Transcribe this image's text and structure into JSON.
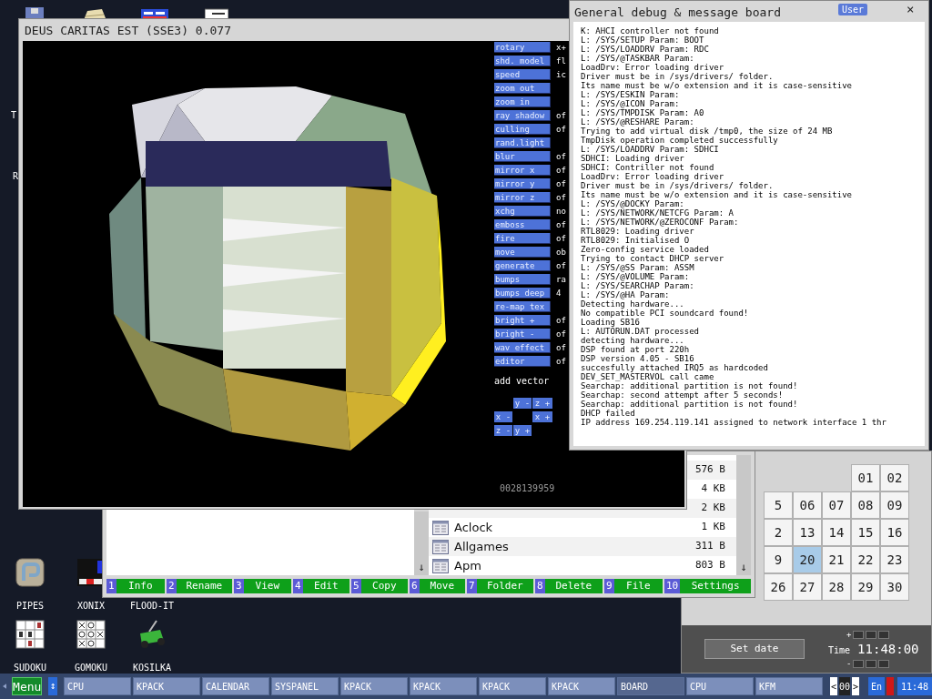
{
  "desktop": {
    "label_fragments": [
      "T",
      "R"
    ],
    "icons": [
      {
        "kind": "pipes",
        "label": "PIPES"
      },
      {
        "kind": "xonix",
        "label": "XONIX"
      },
      {
        "kind": "hidden",
        "label": "FLOOD-IT"
      },
      {
        "kind": "sudoku",
        "label": "SUDOKU"
      },
      {
        "kind": "gomoku",
        "label": "GOMOKU"
      },
      {
        "kind": "mower",
        "label": "KOSILKA"
      }
    ]
  },
  "render_window": {
    "title": "DEUS CARITAS EST (SSE3) 0.077",
    "controls": [
      {
        "label": "rotary",
        "value": "x+"
      },
      {
        "label": "shd. model",
        "value": "fl"
      },
      {
        "label": "speed",
        "value": "ic"
      },
      {
        "label": "zoom out"
      },
      {
        "label": "zoom in"
      },
      {
        "label": "ray shadow",
        "value": "of"
      },
      {
        "label": "culling",
        "value": "of"
      },
      {
        "label": "rand.light"
      },
      {
        "label": "blur",
        "value": "of"
      },
      {
        "label": "mirror x",
        "value": "of"
      },
      {
        "label": "mirror y",
        "value": "of"
      },
      {
        "label": "mirror z",
        "value": "of"
      },
      {
        "label": "xchg",
        "value": "no"
      },
      {
        "label": "emboss",
        "value": "of"
      },
      {
        "label": "fire",
        "value": "of"
      },
      {
        "label": "move",
        "value": "ob"
      },
      {
        "label": "generate",
        "value": "of"
      },
      {
        "label": "bumps",
        "value": "ra"
      },
      {
        "label": "bumps deep",
        "value": "4"
      },
      {
        "label": "re-map tex"
      },
      {
        "label": "bright +",
        "value": "of"
      },
      {
        "label": "bright -",
        "value": "of"
      },
      {
        "label": "wav effect",
        "value": "of"
      },
      {
        "label": "editor",
        "value": "of"
      }
    ],
    "add_vector_label": "add vector",
    "vector_buttons": [
      "y -",
      "z +",
      "x -",
      "x +",
      "z -",
      "y +"
    ],
    "counter": "0028139959"
  },
  "file_manager": {
    "files": [
      {
        "size": "576 B"
      },
      {
        "size": "4 KB"
      },
      {
        "size": "2 KB"
      },
      {
        "name": "Aclock",
        "size": "1 KB"
      },
      {
        "name": "Allgames",
        "size": "311 B"
      },
      {
        "name": "Apm",
        "size": "803 B"
      }
    ],
    "scroll_arrows": [
      "↓",
      "↓"
    ],
    "function_keys": [
      {
        "key": "1",
        "label": "Info"
      },
      {
        "key": "2",
        "label": "Rename"
      },
      {
        "key": "3",
        "label": "View"
      },
      {
        "key": "4",
        "label": "Edit"
      },
      {
        "key": "5",
        "label": "Copy"
      },
      {
        "key": "6",
        "label": "Move"
      },
      {
        "key": "7",
        "label": "Folder"
      },
      {
        "key": "8",
        "label": "Delete"
      },
      {
        "key": "9",
        "label": "File"
      },
      {
        "key": "10",
        "label": "Settings"
      }
    ]
  },
  "debug_board": {
    "title": "General debug & message board",
    "user_button": "User",
    "close": "×",
    "lines": [
      "K: AHCI controller not found",
      "L: /SYS/SETUP Param: BOOT",
      "L: /SYS/LOADDRV Param: RDC",
      "L: /SYS/@TASKBAR Param:",
      "LoadDrv: Error loading driver",
      "Driver must be in /sys/drivers/ folder.",
      "Its name must be w/o extension and it is case-sensitive",
      "L: /SYS/ESKIN Param:",
      "L: /SYS/@ICON Param:",
      "L: /SYS/TMPDISK Param: A0",
      "L: /SYS/@RESHARE Param:",
      "Trying to add virtual disk /tmp0, the size of 24 MB",
      "TmpDisk operation completed successfully",
      "L: /SYS/LOADDRV Param: SDHCI",
      "SDHCI: Loading driver",
      "SDHCI: Contriller not found",
      "LoadDrv: Error loading driver",
      "Driver must be in /sys/drivers/ folder.",
      "Its name must be w/o extension and it is case-sensitive",
      "L: /SYS/@DOCKY Param:",
      "L: /SYS/NETWORK/NETCFG Param: A",
      "L: /SYS/NETWORK/@ZEROCONF Param:",
      "RTL8029: Loading driver",
      "RTL8029: Initialised O",
      "Zero-config service loaded",
      "Trying to contact DHCP server",
      "L: /SYS/@SS Param: ASSM",
      "L: /SYS/@VOLUME Param:",
      "L: /SYS/SEARCHAP Param:",
      "L: /SYS/@HA Param:",
      "Detecting hardware...",
      "No compatible PCI soundcard found!",
      "Loading SB16",
      "L: AUTORUN.DAT processed",
      "detecting hardware...",
      "DSP found at port 220h",
      "DSP version 4.05 - SB16",
      "succesfully attached IRQ5 as hardcoded",
      "DEV_SET_MASTERVOL call came",
      "Searchap: additional partition is not found!",
      "Searchap: second attempt after 5 seconds!",
      "Searchap: additional partition is not found!",
      "DHCP failed",
      "IP address 169.254.119.141 assigned to network interface 1 thr"
    ]
  },
  "calendar": {
    "rows": [
      [
        null,
        null,
        null,
        {
          "text": "01",
          "selected": false
        },
        {
          "text": "02",
          "selected": false
        }
      ],
      [
        {
          "text": "5",
          "selected": false
        },
        {
          "text": "06",
          "selected": false
        },
        {
          "text": "07",
          "selected": false
        },
        {
          "text": "08",
          "selected": false
        },
        {
          "text": "09",
          "selected": false
        }
      ],
      [
        {
          "text": "2",
          "selected": false
        },
        {
          "text": "13",
          "selected": false
        },
        {
          "text": "14",
          "selected": false
        },
        {
          "text": "15",
          "selected": false
        },
        {
          "text": "16",
          "selected": false
        }
      ],
      [
        {
          "text": "9",
          "selected": false
        },
        {
          "text": "20",
          "selected": true
        },
        {
          "text": "21",
          "selected": false
        },
        {
          "text": "22",
          "selected": false
        },
        {
          "text": "23",
          "selected": false
        }
      ],
      [
        {
          "text": "26",
          "selected": false
        },
        {
          "text": "27",
          "selected": false
        },
        {
          "text": "28",
          "selected": false
        },
        {
          "text": "29",
          "selected": false
        },
        {
          "text": "30",
          "selected": false
        }
      ]
    ],
    "set_date_button": "Set date",
    "plus": "+",
    "minus": "-",
    "time_label": "Time",
    "time": "11:48:00"
  },
  "taskbar": {
    "menu": "Menu",
    "swap": "↕",
    "tasks": [
      {
        "label": "CPU",
        "selected": false
      },
      {
        "label": "KPACK",
        "selected": false
      },
      {
        "label": "CALENDAR",
        "selected": false
      },
      {
        "label": "SYSPANEL",
        "selected": false
      },
      {
        "label": "KPACK",
        "selected": false
      },
      {
        "label": "KPACK",
        "selected": false
      },
      {
        "label": "KPACK",
        "selected": false
      },
      {
        "label": "KPACK",
        "selected": false
      },
      {
        "label": "BOARD",
        "selected": true
      },
      {
        "label": "CPU",
        "selected": false
      },
      {
        "label": "KFM",
        "selected": false
      }
    ],
    "prev": "<",
    "page": "00",
    "next": ">",
    "language": "En",
    "clock": "11:48"
  }
}
